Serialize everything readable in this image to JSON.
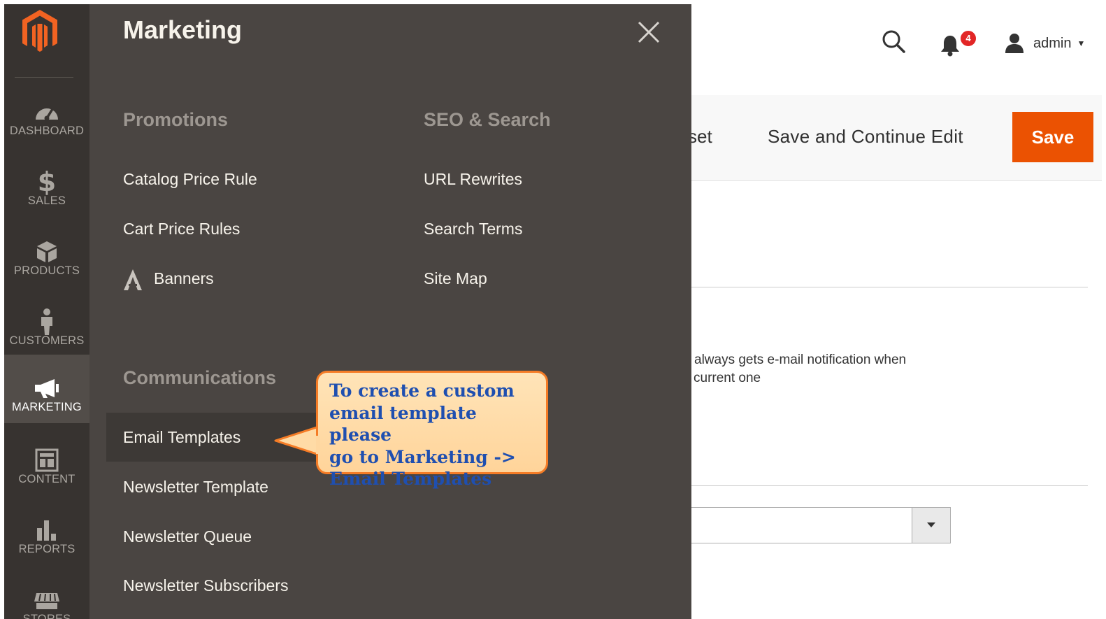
{
  "header": {
    "notification_count": "4",
    "user_name": "admin"
  },
  "action_bar": {
    "reset_label_partial": "set",
    "save_continue_label": "Save and Continue Edit",
    "save_label": "Save"
  },
  "page_content": {
    "note_line1": "always gets e-mail notification when",
    "note_line2": "current one"
  },
  "sidebar": {
    "items": [
      {
        "label": "DASHBOARD",
        "icon": "dashboard-gauge-icon"
      },
      {
        "label": "SALES",
        "icon": "dollar-icon"
      },
      {
        "label": "PRODUCTS",
        "icon": "cube-icon"
      },
      {
        "label": "CUSTOMERS",
        "icon": "person-icon"
      },
      {
        "label": "MARKETING",
        "icon": "megaphone-icon"
      },
      {
        "label": "CONTENT",
        "icon": "layout-icon"
      },
      {
        "label": "REPORTS",
        "icon": "bar-chart-icon"
      },
      {
        "label": "STORES",
        "icon": "store-icon"
      }
    ]
  },
  "flyout": {
    "title": "Marketing",
    "sections": {
      "promotions": {
        "title": "Promotions",
        "items": [
          "Catalog Price Rule",
          "Cart Price Rules",
          "Banners"
        ]
      },
      "seo": {
        "title": "SEO & Search",
        "items": [
          "URL Rewrites",
          "Search Terms",
          "Site Map"
        ]
      },
      "communications": {
        "title": "Communications",
        "items": [
          "Email Templates",
          "Newsletter Template",
          "Newsletter Queue",
          "Newsletter Subscribers"
        ]
      }
    }
  },
  "callout": {
    "lines": [
      "To create a custom",
      "email template please",
      "go to Marketing ->",
      "Email Templates"
    ]
  },
  "colors": {
    "accent": "#eb5202",
    "sidebar_bg": "#373330",
    "flyout_bg": "#4a4542",
    "callout_border": "#f57c26",
    "callout_text": "#1f4fb0"
  }
}
